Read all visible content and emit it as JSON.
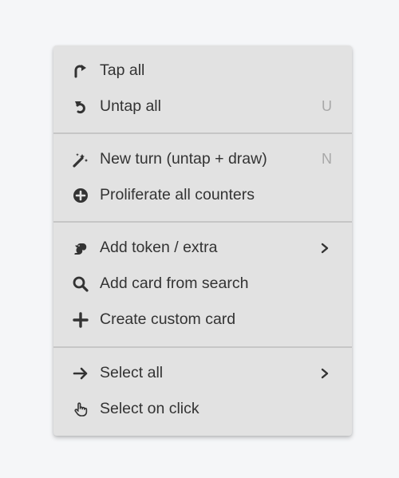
{
  "menu": {
    "sections": [
      {
        "items": [
          {
            "label": "Tap all",
            "icon": "tap-icon",
            "shortcut": ""
          },
          {
            "label": "Untap all",
            "icon": "untap-icon",
            "shortcut": "U"
          }
        ]
      },
      {
        "items": [
          {
            "label": "New turn (untap + draw)",
            "icon": "magic-wand-icon",
            "shortcut": "N"
          },
          {
            "label": "Proliferate all counters",
            "icon": "plus-circle-icon",
            "shortcut": ""
          }
        ]
      },
      {
        "items": [
          {
            "label": "Add token / extra",
            "icon": "squirrel-icon",
            "submenu": true
          },
          {
            "label": "Add card from search",
            "icon": "search-icon"
          },
          {
            "label": "Create custom card",
            "icon": "plus-icon"
          }
        ]
      },
      {
        "items": [
          {
            "label": "Select all",
            "icon": "arrow-right-icon",
            "submenu": true
          },
          {
            "label": "Select on click",
            "icon": "hand-pointer-icon"
          }
        ]
      }
    ],
    "colors": {
      "background": "#e2e2e2",
      "text": "#333333",
      "shortcut": "#a8a8a8",
      "divider": "#c6c6c6"
    }
  }
}
